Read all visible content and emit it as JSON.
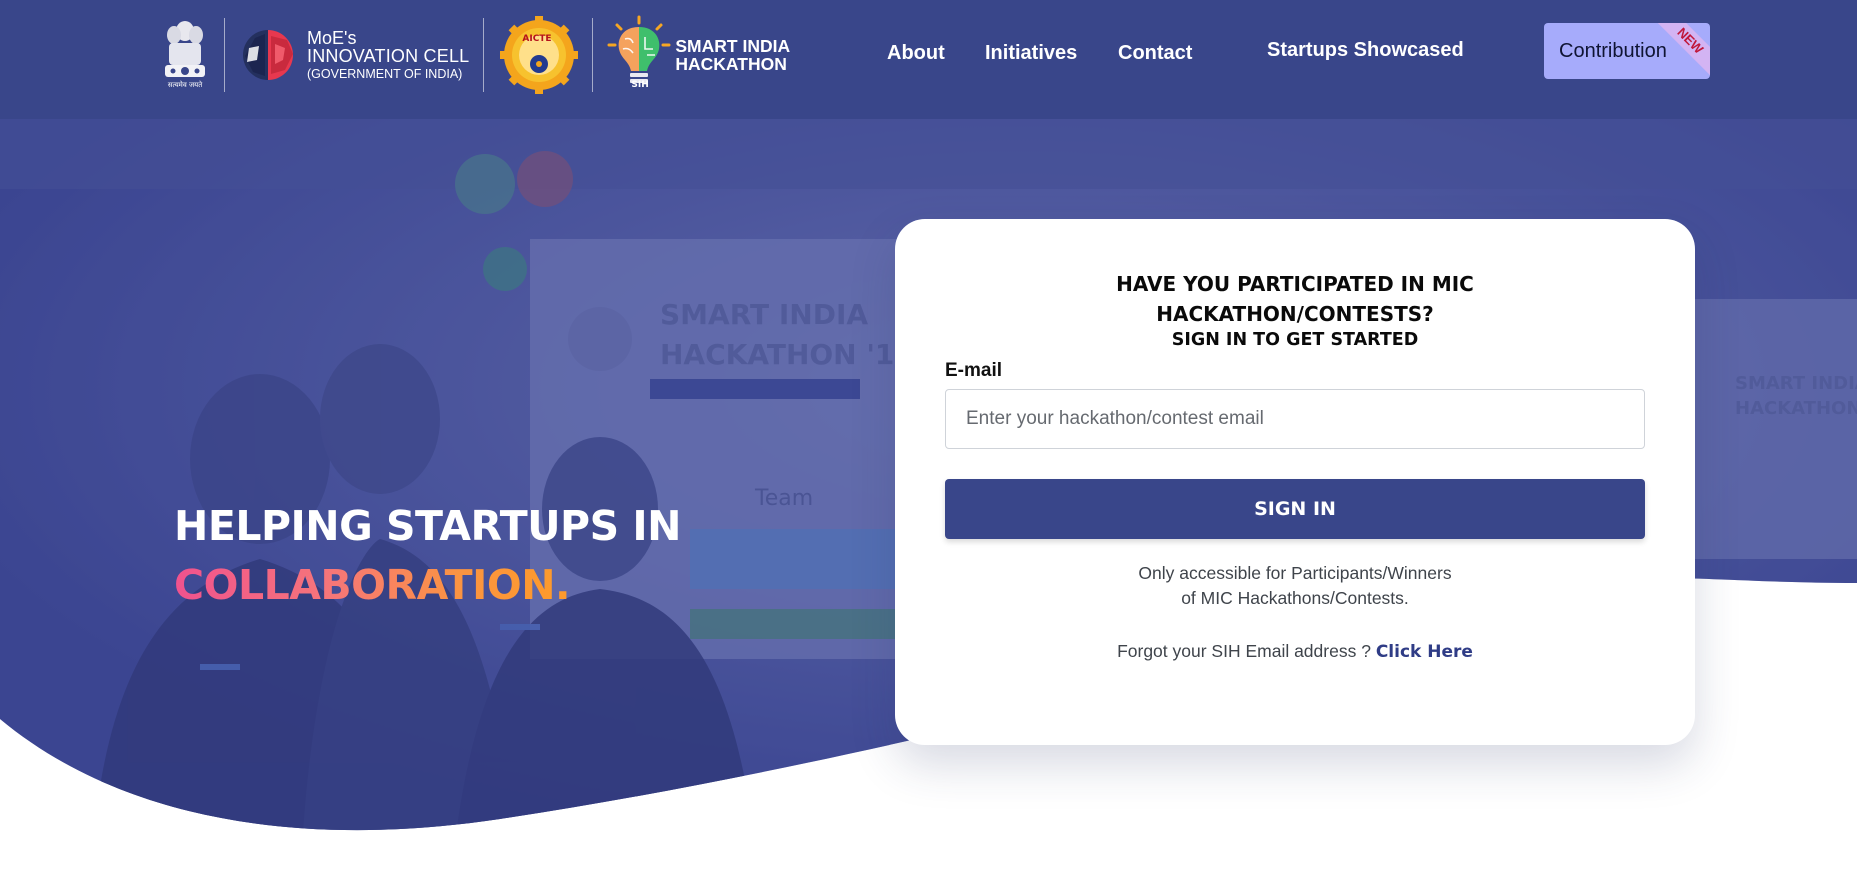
{
  "header": {
    "logos": {
      "emblem": {
        "icon": "national-emblem-icon",
        "caption": "सत्यमेव जयते"
      },
      "moe": {
        "icon": "innovation-cell-brain-icon",
        "line1": "MoE's",
        "line2": "INNOVATION CELL",
        "line3": "(GOVERNMENT OF INDIA)"
      },
      "aicte": {
        "icon": "aicte-gear-logo-icon",
        "text": "AICTE"
      },
      "sih": {
        "icon": "sih-bulb-brain-icon",
        "line1": "SMART INDIA",
        "line2": "HACKATHON",
        "badge": "SIH"
      }
    },
    "nav": [
      {
        "label": "About"
      },
      {
        "label": "Initiatives"
      },
      {
        "label": "Contact"
      },
      {
        "label": "Startups Showcased"
      }
    ],
    "contribution": {
      "label": "Contribution",
      "ribbon": "NEW"
    }
  },
  "hero": {
    "headline_line1": "HELPING STARTUPS IN",
    "headline_line2": "COLLABORATION",
    "headline_dot": ".",
    "background": "photo of hackathon participants with 'SMART INDIA HACKATHON '17' banners",
    "overlay_color": "#3b4691"
  },
  "signin_card": {
    "title_line1": "HAVE YOU PARTICIPATED IN MIC",
    "title_line2": "HACKATHON/CONTESTS?",
    "subtitle": "SIGN IN TO GET STARTED",
    "email_label": "E-mail",
    "email_placeholder": "Enter your hackathon/contest email",
    "button_label": "SIGN IN",
    "note_line1": "Only accessible for Participants/Winners",
    "note_line2": "of MIC Hackathons/Contests.",
    "forgot_text": "Forgot your SIH Email address ?",
    "forgot_link": "Click Here"
  },
  "colors": {
    "primary": "#39468a",
    "contribution_bg": "#a6abfb",
    "gradient_start": "#f0528e",
    "gradient_end": "#fd9a2c",
    "link": "#2f3c86"
  }
}
